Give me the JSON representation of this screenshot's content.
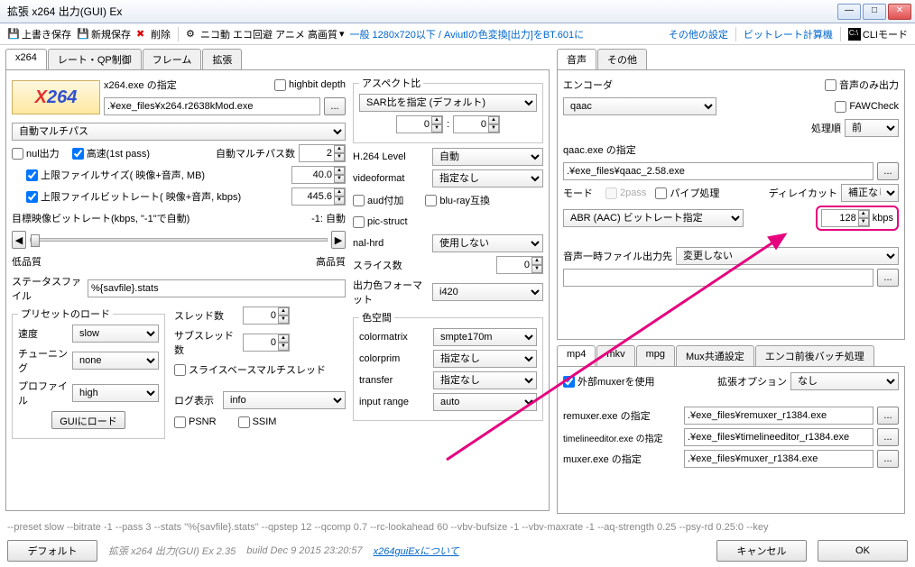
{
  "window": {
    "title": "拡張 x264 出力(GUI) Ex"
  },
  "toolbar": {
    "save_overwrite": "上書き保存",
    "save_new": "新規保存",
    "delete": "削除",
    "nico": "ニコ動 エコ回避 アニメ 高画質",
    "general": "一般 1280x720以下 / Aviutlの色変換[出力]をBT.601に",
    "other_settings": "その他の設定",
    "bitrate_calc": "ビットレート計算機",
    "cli_mode": "CLIモード"
  },
  "left_tabs": [
    "x264",
    "レート・QP制御",
    "フレーム",
    "拡張"
  ],
  "x264": {
    "exe_label": "x264.exe の指定",
    "highbit": "highbit depth",
    "exe_path": ".¥exe_files¥x264.r2638kMod.exe",
    "multipass": "自動マルチパス",
    "nul_out": "nul出力",
    "fast_1st": "高速(1st pass)",
    "multipass_num_label": "自動マルチパス数",
    "multipass_num": "2",
    "limit_filesize": "上限ファイルサイズ( 映像+音声, MB)",
    "limit_filesize_val": "40.0",
    "limit_bitrate": "上限ファイルビットレート( 映像+音声, kbps)",
    "limit_bitrate_val": "445.6",
    "target_bitrate_label": "目標映像ビットレート(kbps, \"-1\"で自動)",
    "target_bitrate_val": "-1: 自動",
    "low_q": "低品質",
    "high_q": "高品質",
    "stats_label": "ステータスファイル",
    "stats_val": "%{savfile}.stats",
    "preset_group": "プリセットのロード",
    "speed_label": "速度",
    "speed_val": "slow",
    "tuning_label": "チューニング",
    "tuning_val": "none",
    "profile_label": "プロファイル",
    "profile_val": "high",
    "gui_load": "GUIにロード",
    "threads_label": "スレッド数",
    "threads_val": "0",
    "subthreads_label": "サブスレッド数",
    "subthreads_val": "0",
    "slice_mt": "スライスベースマルチスレッド",
    "log_label": "ログ表示",
    "log_val": "info",
    "psnr": "PSNR",
    "ssim": "SSIM"
  },
  "mid": {
    "aspect_group": "アスペクト比",
    "aspect_mode": "SAR比を指定 (デフォルト)",
    "aspect_w": "0",
    "aspect_h": "0",
    "h264_level": "H.264 Level",
    "h264_level_val": "自動",
    "videoformat": "videoformat",
    "videoformat_val": "指定なし",
    "aud": "aud付加",
    "bluray": "blu-ray互換",
    "picstruct": "pic-struct",
    "nalhrd": "nal-hrd",
    "nalhrd_val": "使用しない",
    "slice_num": "スライス数",
    "slice_num_val": "0",
    "output_color": "出力色フォーマット",
    "output_color_val": "i420",
    "colorspace_group": "色空間",
    "colormatrix": "colormatrix",
    "colormatrix_val": "smpte170m",
    "colorprim": "colorprim",
    "colorprim_val": "指定なし",
    "transfer": "transfer",
    "transfer_val": "指定なし",
    "input_range": "input range",
    "input_range_val": "auto"
  },
  "right_tabs": [
    "音声",
    "その他"
  ],
  "audio": {
    "encoder_label": "エンコーダ",
    "encoder_val": "qaac",
    "audio_only": "音声のみ出力",
    "fawcheck": "FAWCheck",
    "order_label": "処理順",
    "order_val": "前",
    "qaac_exe_label": "qaac.exe の指定",
    "qaac_exe_path": ".¥exe_files¥qaac_2.58.exe",
    "mode_label": "モード",
    "twopass": "2pass",
    "pipe": "パイプ処理",
    "delay_label": "ディレイカット",
    "delay_val": "補正なし",
    "mode_val": "ABR (AAC) ビットレート指定",
    "bitrate_val": "128",
    "bitrate_unit": "kbps",
    "tempfile_label": "音声一時ファイル出力先",
    "tempfile_val": "変更しない"
  },
  "mux_tabs": [
    "mp4",
    "mkv",
    "mpg",
    "Mux共通設定",
    "エンコ前後バッチ処理"
  ],
  "mux": {
    "ext_muxer": "外部muxerを使用",
    "ext_opt_label": "拡張オプション",
    "ext_opt_val": "なし",
    "remuxer_label": "remuxer.exe の指定",
    "remuxer_path": ".¥exe_files¥remuxer_r1384.exe",
    "tleditor_label": "timelineeditor.exe の指定",
    "tleditor_path": ".¥exe_files¥timelineeditor_r1384.exe",
    "muxer_label": "muxer.exe の指定",
    "muxer_path": ".¥exe_files¥muxer_r1384.exe"
  },
  "status": "--preset slow --bitrate -1 --pass 3 --stats \"%{savfile}.stats\" --qpstep 12 --qcomp 0.7 --rc-lookahead 60 --vbv-bufsize -1 --vbv-maxrate -1 --aq-strength 0.25 --psy-rd 0.25:0 --key",
  "bottom": {
    "default": "デフォルト",
    "app_name": "拡張 x264 出力(GUI) Ex 2.35",
    "build": "build Dec  9 2015 23:20:57",
    "about": "x264guiExについて",
    "cancel": "キャンセル",
    "ok": "OK"
  }
}
